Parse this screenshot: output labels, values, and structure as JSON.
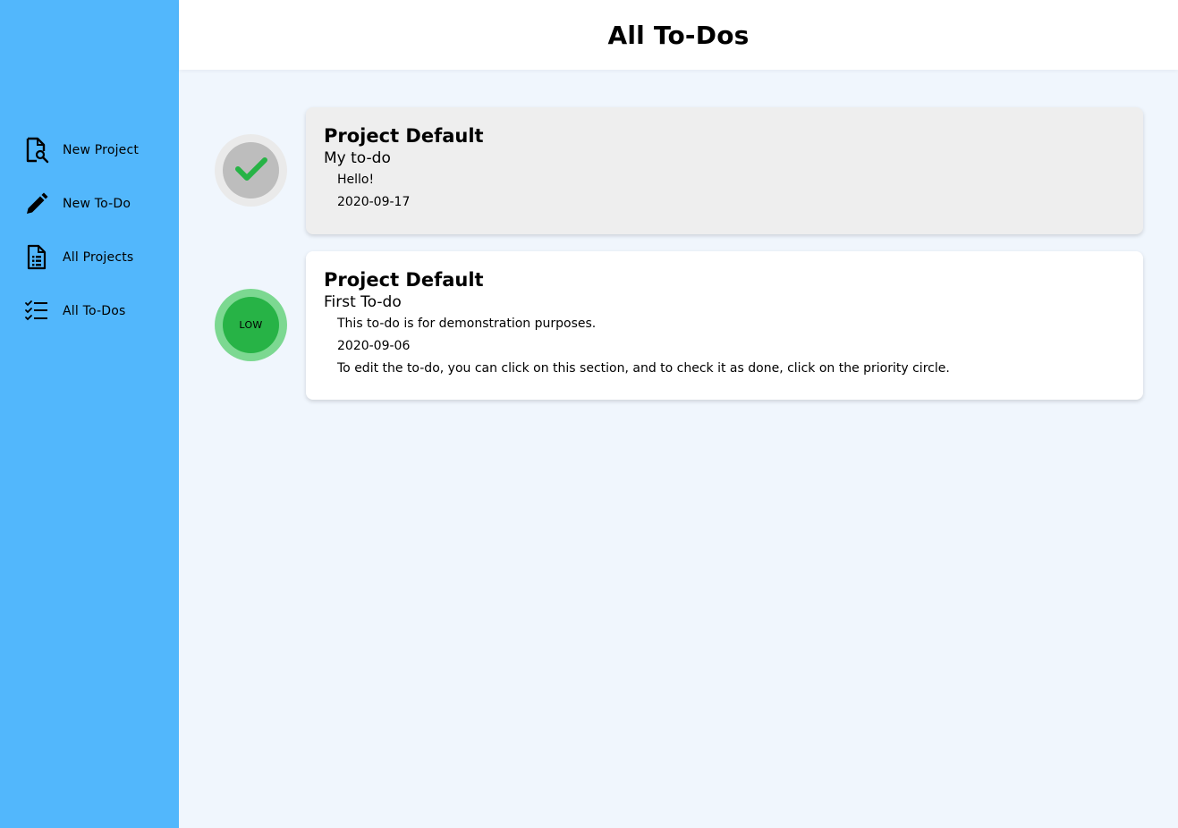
{
  "header": {
    "title": "All To-Dos"
  },
  "sidebar": {
    "items": [
      {
        "label": "New Project",
        "icon": "new-project-icon"
      },
      {
        "label": "New To-Do",
        "icon": "pencil-icon"
      },
      {
        "label": "All Projects",
        "icon": "document-list-icon"
      },
      {
        "label": "All To-Dos",
        "icon": "checklist-icon"
      }
    ]
  },
  "todos": [
    {
      "project": "Project Default",
      "title": "My to-do",
      "description": "Hello!",
      "date": "2020-09-17",
      "notes": "",
      "done": true,
      "priority": ""
    },
    {
      "project": "Project Default",
      "title": "First To-do",
      "description": "This to-do is for demonstration purposes.",
      "date": "2020-09-06",
      "notes": "To edit the to-do, you can click on this section, and to check it as done, click on the priority circle.",
      "done": false,
      "priority": "LOW"
    }
  ],
  "colors": {
    "sidebar": "#52b7fc",
    "background": "#f0f6fd",
    "priority_low": "#27b346",
    "check": "#27b346"
  }
}
